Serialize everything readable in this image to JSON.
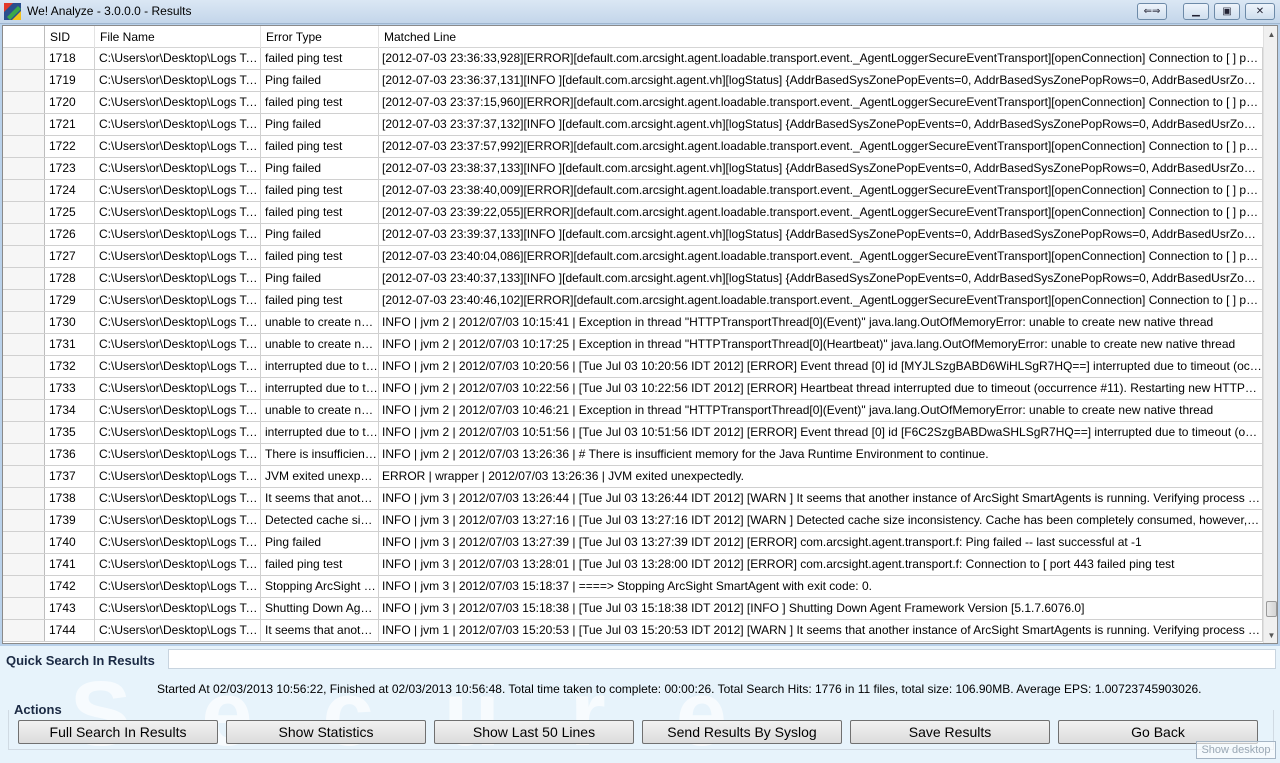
{
  "window": {
    "title": "We! Analyze - 3.0.0.0 - Results",
    "buttons": {
      "swap": "⇐⇒",
      "minimize": "▁",
      "maximize": "▣",
      "close": "✕"
    }
  },
  "grid": {
    "columns": [
      "SID",
      "File Name",
      "Error Type",
      "Matched Line"
    ],
    "rows": [
      {
        "sid": "1718",
        "file": "C:\\Users\\or\\Desktop\\Logs To ...",
        "error": "failed ping test",
        "line": "[2012-07-03 23:36:33,928][ERROR][default.com.arcsight.agent.loadable.transport.event._AgentLoggerSecureEventTransport][openConnection] Connection to [                    ] port ..."
      },
      {
        "sid": "1719",
        "file": "C:\\Users\\or\\Desktop\\Logs To ...",
        "error": "Ping failed",
        "line": "[2012-07-03 23:36:37,131][INFO ][default.com.arcsight.agent.vh][logStatus] {AddrBasedSysZonePopEvents=0, AddrBasedSysZonePopRows=0, AddrBasedUsrZonePopEvents=0, Ad..."
      },
      {
        "sid": "1720",
        "file": "C:\\Users\\or\\Desktop\\Logs To ...",
        "error": "failed ping test",
        "line": "[2012-07-03 23:37:15,960][ERROR][default.com.arcsight.agent.loadable.transport.event._AgentLoggerSecureEventTransport][openConnection] Connection to [                    ] port ..."
      },
      {
        "sid": "1721",
        "file": "C:\\Users\\or\\Desktop\\Logs To ...",
        "error": "Ping failed",
        "line": "[2012-07-03 23:37:37,132][INFO ][default.com.arcsight.agent.vh][logStatus] {AddrBasedSysZonePopEvents=0, AddrBasedSysZonePopRows=0, AddrBasedUsrZonePopEvents=0, Ad..."
      },
      {
        "sid": "1722",
        "file": "C:\\Users\\or\\Desktop\\Logs To ...",
        "error": "failed ping test",
        "line": "[2012-07-03 23:37:57,992][ERROR][default.com.arcsight.agent.loadable.transport.event._AgentLoggerSecureEventTransport][openConnection] Connection to [                    ] port ..."
      },
      {
        "sid": "1723",
        "file": "C:\\Users\\or\\Desktop\\Logs To ...",
        "error": "Ping failed",
        "line": "[2012-07-03 23:38:37,133][INFO ][default.com.arcsight.agent.vh][logStatus] {AddrBasedSysZonePopEvents=0, AddrBasedSysZonePopRows=0, AddrBasedUsrZonePopEvents=0, Ad..."
      },
      {
        "sid": "1724",
        "file": "C:\\Users\\or\\Desktop\\Logs To ...",
        "error": "failed ping test",
        "line": "[2012-07-03 23:38:40,009][ERROR][default.com.arcsight.agent.loadable.transport.event._AgentLoggerSecureEventTransport][openConnection] Connection to [                    ] port ..."
      },
      {
        "sid": "1725",
        "file": "C:\\Users\\or\\Desktop\\Logs To ...",
        "error": "failed ping test",
        "line": "[2012-07-03 23:39:22,055][ERROR][default.com.arcsight.agent.loadable.transport.event._AgentLoggerSecureEventTransport][openConnection] Connection to [                    ] port ..."
      },
      {
        "sid": "1726",
        "file": "C:\\Users\\or\\Desktop\\Logs To ...",
        "error": "Ping failed",
        "line": "[2012-07-03 23:39:37,133][INFO ][default.com.arcsight.agent.vh][logStatus] {AddrBasedSysZonePopEvents=0, AddrBasedSysZonePopRows=0, AddrBasedUsrZonePopEvents=0, Ad..."
      },
      {
        "sid": "1727",
        "file": "C:\\Users\\or\\Desktop\\Logs To ...",
        "error": "failed ping test",
        "line": "[2012-07-03 23:40:04,086][ERROR][default.com.arcsight.agent.loadable.transport.event._AgentLoggerSecureEventTransport][openConnection] Connection to [                    ] port ..."
      },
      {
        "sid": "1728",
        "file": "C:\\Users\\or\\Desktop\\Logs To ...",
        "error": "Ping failed",
        "line": "[2012-07-03 23:40:37,133][INFO ][default.com.arcsight.agent.vh][logStatus] {AddrBasedSysZonePopEvents=0, AddrBasedSysZonePopRows=0, AddrBasedUsrZonePopEvents=0, Ad..."
      },
      {
        "sid": "1729",
        "file": "C:\\Users\\or\\Desktop\\Logs To ...",
        "error": "failed ping test",
        "line": "[2012-07-03 23:40:46,102][ERROR][default.com.arcsight.agent.loadable.transport.event._AgentLoggerSecureEventTransport][openConnection] Connection to [                    ] port ..."
      },
      {
        "sid": "1730",
        "file": "C:\\Users\\or\\Desktop\\Logs To ...",
        "error": "unable to create new...",
        "line": "INFO   | jvm 2    | 2012/07/03 10:15:41 | Exception in thread \"HTTPTransportThread[0](Event)\" java.lang.OutOfMemoryError: unable to create new native thread"
      },
      {
        "sid": "1731",
        "file": "C:\\Users\\or\\Desktop\\Logs To ...",
        "error": "unable to create new...",
        "line": "INFO   | jvm 2    | 2012/07/03 10:17:25 | Exception in thread \"HTTPTransportThread[0](Heartbeat)\" java.lang.OutOfMemoryError: unable to create new native thread"
      },
      {
        "sid": "1732",
        "file": "C:\\Users\\or\\Desktop\\Logs To ...",
        "error": "interrupted due to tim...",
        "line": "INFO   | jvm 2    | 2012/07/03 10:20:56 | [Tue Jul 03 10:20:56 IDT 2012] [ERROR] Event thread [0] id [MYJLSzgBABD6WiHLSgR7HQ==] interrupted due to timeout (occurrence #10). ..."
      },
      {
        "sid": "1733",
        "file": "C:\\Users\\or\\Desktop\\Logs To ...",
        "error": "interrupted due to tim...",
        "line": "INFO   | jvm 2    | 2012/07/03 10:22:56 | [Tue Jul 03 10:22:56 IDT 2012] [ERROR] Heartbeat thread interrupted due to timeout (occurrence #11).  Restarting new HTTPTransportThread"
      },
      {
        "sid": "1734",
        "file": "C:\\Users\\or\\Desktop\\Logs To ...",
        "error": "unable to create new...",
        "line": "INFO   | jvm 2    | 2012/07/03 10:46:21 | Exception in thread \"HTTPTransportThread[0](Event)\" java.lang.OutOfMemoryError: unable to create new native thread"
      },
      {
        "sid": "1735",
        "file": "C:\\Users\\or\\Desktop\\Logs To ...",
        "error": "interrupted due to tim...",
        "line": "INFO   | jvm 2    | 2012/07/03 10:51:56 | [Tue Jul 03 10:51:56 IDT 2012] [ERROR] Event thread [0] id [F6C2SzgBABDwaSHLSgR7HQ==] interrupted due to timeout (occurrence #12). ..."
      },
      {
        "sid": "1736",
        "file": "C:\\Users\\or\\Desktop\\Logs To ...",
        "error": "There is insufficient ...",
        "line": "INFO   | jvm 2    | 2012/07/03 13:26:36 | # There is insufficient memory for the Java Runtime Environment to continue."
      },
      {
        "sid": "1737",
        "file": "C:\\Users\\or\\Desktop\\Logs To ...",
        "error": "JVM exited unexpect...",
        "line": "ERROR  | wrapper  | 2012/07/03 13:26:36 | JVM exited unexpectedly."
      },
      {
        "sid": "1738",
        "file": "C:\\Users\\or\\Desktop\\Logs To ...",
        "error": "It seems that another...",
        "line": "INFO   | jvm 3    | 2012/07/03 13:26:44 | [Tue Jul 03 13:26:44 IDT 2012] [WARN ] It seems that another instance of ArcSight SmartAgents is running. Verifying process heartbeat in [30]..."
      },
      {
        "sid": "1739",
        "file": "C:\\Users\\or\\Desktop\\Logs To ...",
        "error": "Detected cache size ...",
        "line": "INFO   | jvm 3    | 2012/07/03 13:27:16 | [Tue Jul 03 13:27:16 IDT 2012] [WARN ] Detected cache size inconsistency. Cache has been completely consumed, however, size reported ..."
      },
      {
        "sid": "1740",
        "file": "C:\\Users\\or\\Desktop\\Logs To ...",
        "error": "Ping failed",
        "line": "INFO   | jvm 3    | 2012/07/03 13:27:39 | [Tue Jul 03 13:27:39 IDT 2012] [ERROR] com.arcsight.agent.transport.f: Ping failed -- last successful at -1"
      },
      {
        "sid": "1741",
        "file": "C:\\Users\\or\\Desktop\\Logs To ...",
        "error": "failed ping test",
        "line": "INFO   | jvm 3    | 2012/07/03 13:28:01 | [Tue Jul 03 13:28:00 IDT 2012] [ERROR] com.arcsight.agent.transport.f: Connection to [                      port 443 failed ping test"
      },
      {
        "sid": "1742",
        "file": "C:\\Users\\or\\Desktop\\Logs To ...",
        "error": "Stopping ArcSight S...",
        "line": "INFO   | jvm 3    | 2012/07/03 15:18:37 | ====> Stopping ArcSight SmartAgent with exit code: 0."
      },
      {
        "sid": "1743",
        "file": "C:\\Users\\or\\Desktop\\Logs To ...",
        "error": "Shutting Down Agent...",
        "line": "INFO   | jvm 3    | 2012/07/03 15:18:38 | [Tue Jul 03 15:18:38 IDT 2012] [INFO ] Shutting Down Agent Framework Version [5.1.7.6076.0]"
      },
      {
        "sid": "1744",
        "file": "C:\\Users\\or\\Desktop\\Logs To ...",
        "error": "It seems that another...",
        "line": "INFO   | jvm 1    | 2012/07/03 15:20:53 | [Tue Jul 03 15:20:53 IDT 2012] [WARN ] It seems that another instance of ArcSight SmartAgents is running. Verifying process heartbeat in [30]..."
      }
    ]
  },
  "quick_search": {
    "label": "Quick Search In Results",
    "value": ""
  },
  "summary": "Started At 02/03/2013 10:56:22, Finished at 02/03/2013 10:56:48. Total time taken to complete: 00:00:26. Total Search Hits: 1776 in 11 files, total size: 106.90MB. Average EPS: 1.00723745903026.",
  "watermark": "Secure",
  "actions": {
    "label": "Actions",
    "buttons": [
      "Full Search In Results",
      "Show Statistics",
      "Show Last 50 Lines",
      "Send Results By Syslog",
      "Save Results",
      "Go Back"
    ]
  },
  "show_desktop": "Show desktop"
}
